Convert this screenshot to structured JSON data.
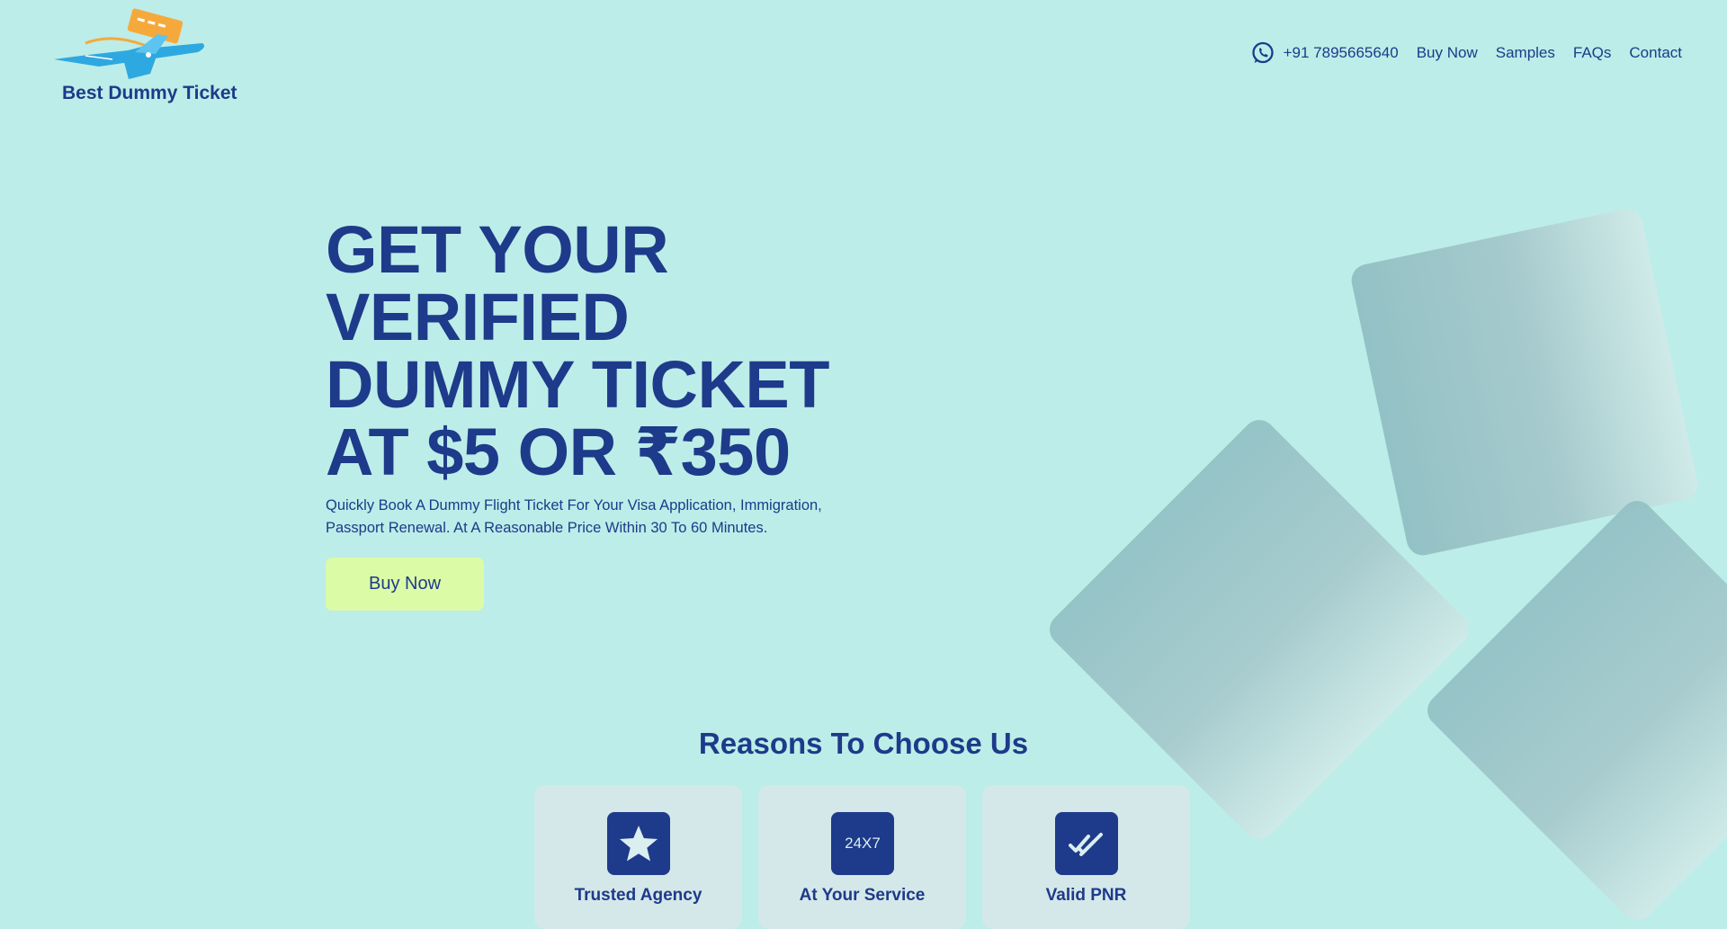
{
  "brand": {
    "name": "Best Dummy Ticket",
    "logo_icon": "airplane-logo-icon"
  },
  "nav": {
    "phone_icon": "whatsapp-icon",
    "phone": "+91 7895665640",
    "items": [
      "Buy Now",
      "Samples",
      "FAQs",
      "Contact"
    ]
  },
  "hero": {
    "title_lines": [
      "GET YOUR",
      "VERIFIED",
      "DUMMY TICKET",
      "AT $5 OR ₹350"
    ],
    "subtitle": "Quickly Book A Dummy Flight Ticket For Your Visa Application, Immigration, Passport Renewal. At A Reasonable Price Within 30 To 60 Minutes.",
    "cta_label": "Buy Now"
  },
  "reasons": {
    "title": "Reasons To Choose Us",
    "cards": [
      {
        "icon": "star-icon",
        "badge_text": "",
        "title": "Trusted Agency"
      },
      {
        "icon": "clock-24x7-icon",
        "badge_text": "24X7",
        "title": "At Your Service"
      },
      {
        "icon": "double-check-icon",
        "badge_text": "",
        "title": "Valid PNR"
      }
    ]
  },
  "colors": {
    "background": "#bcede8",
    "primary": "#1e3a8a",
    "cta": "#dbfba6",
    "card": "#d4e8ea",
    "logo_orange": "#f6a93b",
    "logo_blue": "#2ea8e0"
  }
}
